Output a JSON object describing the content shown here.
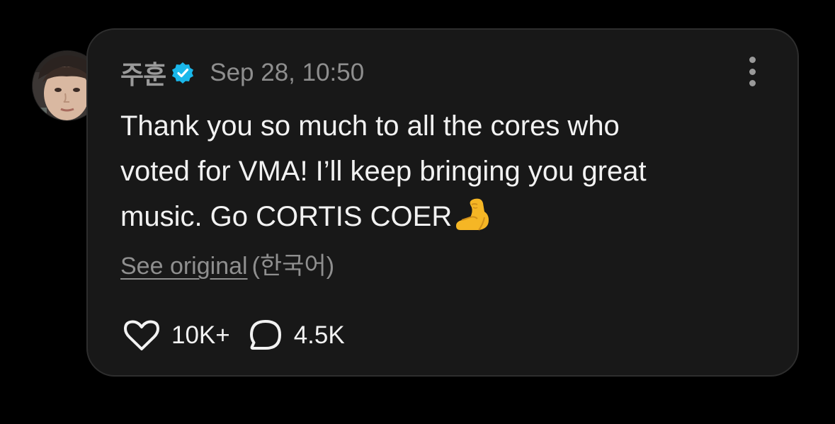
{
  "post": {
    "username": "주훈",
    "verified_icon": "verified-badge-icon",
    "timestamp": "Sep 28, 10:50",
    "text_lines": [
      "Thank you so much to all the cores who",
      "voted for VMA! I’ll keep bringing you great",
      "music. Go CORTIS COER"
    ],
    "emoji": "flexed-biceps-emoji",
    "see_original_label": "See original",
    "original_language": "(한국어)",
    "likes_count": "10K+",
    "replies_count": "4.5K"
  },
  "icons": {
    "like": "heart-icon",
    "reply": "speech-bubble-icon",
    "more": "more-vertical-icon"
  },
  "colors": {
    "background": "#000000",
    "card": "#181818",
    "card_border": "#2e2e2e",
    "text_primary": "#f2f2f2",
    "text_secondary": "#8f8f8f",
    "verified": "#1ab7ea"
  }
}
